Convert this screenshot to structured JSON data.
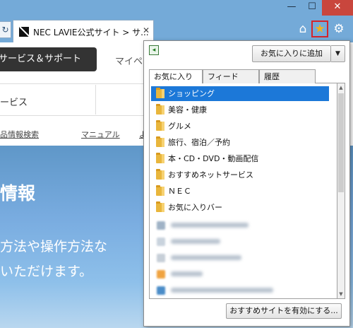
{
  "window": {
    "minimize_glyph": "—",
    "maximize_glyph": "☐",
    "close_glyph": "✕"
  },
  "browser": {
    "refresh_glyph": "↻",
    "tab": {
      "title": "NEC LAVIE公式サイト > サ...",
      "close_glyph": "✕"
    },
    "home_glyph": "⌂",
    "favorites_glyph": "★",
    "tools_glyph": "⚙"
  },
  "page": {
    "support_button": "サービス＆サポート",
    "mypage_link": "マイペ",
    "service_text": "ービス",
    "sublinks": [
      "品情報検索",
      "マニュアル",
      "よ"
    ],
    "hero_title": "情報",
    "hero_lines": [
      "方法や操作方法な",
      "いただけます。"
    ]
  },
  "favorites": {
    "pin_glyph": "◂",
    "add_button": "お気に入りに追加",
    "add_dropdown": "▼",
    "tabs": [
      "お気に入り",
      "フィード",
      "履歴"
    ],
    "items": [
      "ショッピング",
      "美容・健康",
      "グルメ",
      "旅行、宿泊／予約",
      "本・CD・DVD・動画配信",
      "おすすめネットサービス",
      "ＮＥＣ",
      "お気に入りバー"
    ],
    "selected_index": 0,
    "scroll_up": "▲",
    "scroll_down": "▼",
    "recommend_button": "おすすめサイトを有効にする..."
  },
  "colors": {
    "accent": "#1c78d8",
    "folder": "#e9b63c",
    "highlight_border": "#d4242b"
  }
}
